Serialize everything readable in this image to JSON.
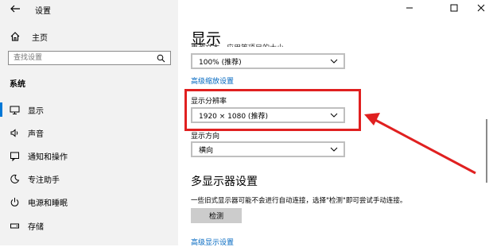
{
  "window": {
    "title": "设置"
  },
  "sidebar": {
    "home_label": "主页",
    "search_placeholder": "查找设置",
    "section_label": "系统",
    "items": [
      {
        "label": "显示",
        "icon": "monitor-icon",
        "active": true
      },
      {
        "label": "声音",
        "icon": "speaker-icon"
      },
      {
        "label": "通知和操作",
        "icon": "notification-icon"
      },
      {
        "label": "专注助手",
        "icon": "moon-icon"
      },
      {
        "label": "电源和睡眠",
        "icon": "power-icon"
      },
      {
        "label": "存储",
        "icon": "storage-icon"
      }
    ]
  },
  "main": {
    "title": "显示",
    "scale_label_partial": "更改文本、应用等项目的大小",
    "scale_value": "100% (推荐)",
    "advanced_scale_link": "高级缩放设置",
    "resolution_label": "显示分辨率",
    "resolution_value": "1920 × 1080 (推荐)",
    "orientation_label": "显示方向",
    "orientation_value": "横向",
    "multi_display_heading": "多显示器设置",
    "multi_display_desc": "一些旧式显示器可能不会进行自动连接，选择\"检测\"即可尝试手动连接。",
    "detect_button": "检测",
    "advanced_display_link": "高级显示设置"
  },
  "colors": {
    "accent": "#0078d7",
    "link": "#0067c0",
    "annotation": "#e02020"
  }
}
